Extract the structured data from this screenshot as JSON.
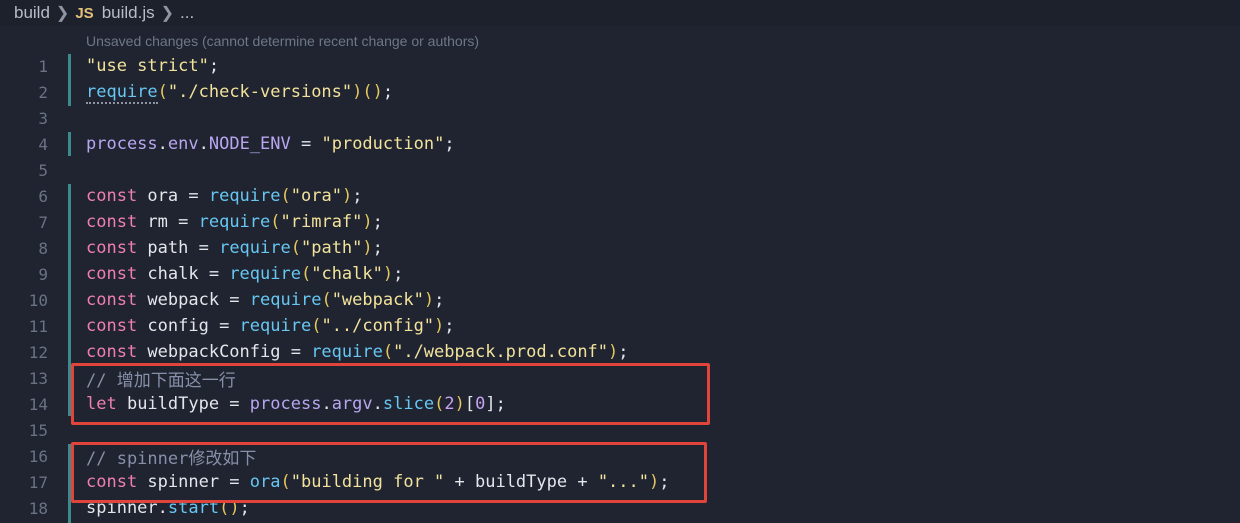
{
  "breadcrumb": {
    "folder": "build",
    "file_badge": "JS",
    "file": "build.js",
    "more": "..."
  },
  "blame_hint": "Unsaved changes (cannot determine recent change or authors)",
  "lines": [
    {
      "n": "1",
      "t": [
        [
          "str",
          "\"use strict\""
        ],
        [
          "plain",
          ";"
        ]
      ]
    },
    {
      "n": "2",
      "t": [
        [
          "fn",
          "require"
        ],
        [
          "par",
          "("
        ],
        [
          "str",
          "\"./check-versions\""
        ],
        [
          "par",
          ")()"
        ],
        [
          "plain",
          ";"
        ]
      ]
    },
    {
      "n": "3",
      "t": []
    },
    {
      "n": "4",
      "t": [
        [
          "prop",
          "process"
        ],
        [
          "plain",
          "."
        ],
        [
          "prop",
          "env"
        ],
        [
          "plain",
          "."
        ],
        [
          "prop",
          "NODE_ENV"
        ],
        [
          "plain",
          " = "
        ],
        [
          "str",
          "\"production\""
        ],
        [
          "plain",
          ";"
        ]
      ]
    },
    {
      "n": "5",
      "t": []
    },
    {
      "n": "6",
      "t": [
        [
          "kw",
          "const"
        ],
        [
          "plain",
          " ora = "
        ],
        [
          "fn",
          "require"
        ],
        [
          "par",
          "("
        ],
        [
          "str",
          "\"ora\""
        ],
        [
          "par",
          ")"
        ],
        [
          "plain",
          ";"
        ]
      ]
    },
    {
      "n": "7",
      "t": [
        [
          "kw",
          "const"
        ],
        [
          "plain",
          " rm = "
        ],
        [
          "fn",
          "require"
        ],
        [
          "par",
          "("
        ],
        [
          "str",
          "\"rimraf\""
        ],
        [
          "par",
          ")"
        ],
        [
          "plain",
          ";"
        ]
      ]
    },
    {
      "n": "8",
      "t": [
        [
          "kw",
          "const"
        ],
        [
          "plain",
          " path = "
        ],
        [
          "fn",
          "require"
        ],
        [
          "par",
          "("
        ],
        [
          "str",
          "\"path\""
        ],
        [
          "par",
          ")"
        ],
        [
          "plain",
          ";"
        ]
      ]
    },
    {
      "n": "9",
      "t": [
        [
          "kw",
          "const"
        ],
        [
          "plain",
          " chalk = "
        ],
        [
          "fn",
          "require"
        ],
        [
          "par",
          "("
        ],
        [
          "str",
          "\"chalk\""
        ],
        [
          "par",
          ")"
        ],
        [
          "plain",
          ";"
        ]
      ]
    },
    {
      "n": "10",
      "t": [
        [
          "kw",
          "const"
        ],
        [
          "plain",
          " webpack = "
        ],
        [
          "fn",
          "require"
        ],
        [
          "par",
          "("
        ],
        [
          "str",
          "\"webpack\""
        ],
        [
          "par",
          ")"
        ],
        [
          "plain",
          ";"
        ]
      ]
    },
    {
      "n": "11",
      "t": [
        [
          "kw",
          "const"
        ],
        [
          "plain",
          " config = "
        ],
        [
          "fn",
          "require"
        ],
        [
          "par",
          "("
        ],
        [
          "str",
          "\"../config\""
        ],
        [
          "par",
          ")"
        ],
        [
          "plain",
          ";"
        ]
      ]
    },
    {
      "n": "12",
      "t": [
        [
          "kw",
          "const"
        ],
        [
          "plain",
          " webpackConfig = "
        ],
        [
          "fn",
          "require"
        ],
        [
          "par",
          "("
        ],
        [
          "str",
          "\"./webpack.prod.conf\""
        ],
        [
          "par",
          ")"
        ],
        [
          "plain",
          ";"
        ]
      ]
    },
    {
      "n": "13",
      "t": [
        [
          "cm",
          "// 增加下面这一行"
        ]
      ]
    },
    {
      "n": "14",
      "t": [
        [
          "kw",
          "let"
        ],
        [
          "plain",
          " buildType = "
        ],
        [
          "prop",
          "process"
        ],
        [
          "plain",
          "."
        ],
        [
          "prop",
          "argv"
        ],
        [
          "plain",
          "."
        ],
        [
          "fn",
          "slice"
        ],
        [
          "par",
          "("
        ],
        [
          "num",
          "2"
        ],
        [
          "par",
          ")"
        ],
        [
          "plain",
          "["
        ],
        [
          "num",
          "0"
        ],
        [
          "plain",
          "];"
        ]
      ]
    },
    {
      "n": "15",
      "t": []
    },
    {
      "n": "16",
      "t": [
        [
          "cm",
          "// spinner修改如下"
        ]
      ]
    },
    {
      "n": "17",
      "t": [
        [
          "kw",
          "const"
        ],
        [
          "plain",
          " spinner = "
        ],
        [
          "fn",
          "ora"
        ],
        [
          "par",
          "("
        ],
        [
          "str",
          "\"building for \""
        ],
        [
          "plain",
          " + buildType + "
        ],
        [
          "str",
          "\"...\""
        ],
        [
          "par",
          ")"
        ],
        [
          "plain",
          ";"
        ]
      ]
    },
    {
      "n": "18",
      "t": [
        [
          "plain",
          "spinner."
        ],
        [
          "fn",
          "start"
        ],
        [
          "par",
          "()"
        ],
        [
          "plain",
          ";"
        ]
      ]
    }
  ],
  "colors": {
    "background": "#1f2430",
    "highlight_box": "#e0443a",
    "gutter_change": "#3c8a8c"
  }
}
